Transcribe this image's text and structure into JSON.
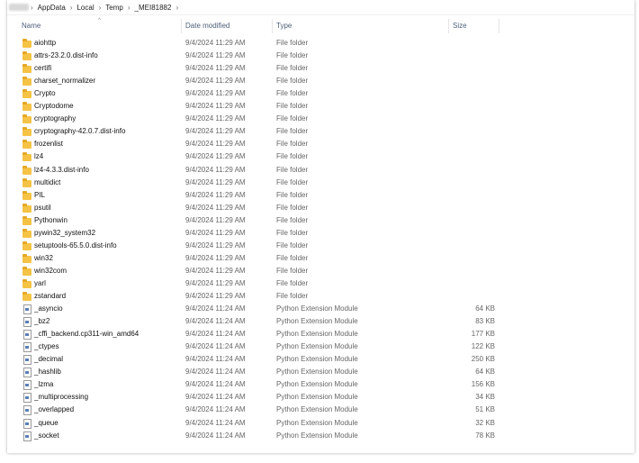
{
  "breadcrumb": [
    "AppData",
    "Local",
    "Temp",
    "_MEI81882"
  ],
  "columns": {
    "name": "Name",
    "date": "Date modified",
    "type": "Type",
    "size": "Size"
  },
  "files": [
    {
      "name": "aiohttp",
      "date": "9/4/2024 11:29 AM",
      "type": "File folder",
      "size": "",
      "kind": "folder"
    },
    {
      "name": "attrs-23.2.0.dist-info",
      "date": "9/4/2024 11:29 AM",
      "type": "File folder",
      "size": "",
      "kind": "folder"
    },
    {
      "name": "certifi",
      "date": "9/4/2024 11:29 AM",
      "type": "File folder",
      "size": "",
      "kind": "folder"
    },
    {
      "name": "charset_normalizer",
      "date": "9/4/2024 11:29 AM",
      "type": "File folder",
      "size": "",
      "kind": "folder"
    },
    {
      "name": "Crypto",
      "date": "9/4/2024 11:29 AM",
      "type": "File folder",
      "size": "",
      "kind": "folder"
    },
    {
      "name": "Cryptodome",
      "date": "9/4/2024 11:29 AM",
      "type": "File folder",
      "size": "",
      "kind": "folder"
    },
    {
      "name": "cryptography",
      "date": "9/4/2024 11:29 AM",
      "type": "File folder",
      "size": "",
      "kind": "folder"
    },
    {
      "name": "cryptography-42.0.7.dist-info",
      "date": "9/4/2024 11:29 AM",
      "type": "File folder",
      "size": "",
      "kind": "folder"
    },
    {
      "name": "frozenlist",
      "date": "9/4/2024 11:29 AM",
      "type": "File folder",
      "size": "",
      "kind": "folder"
    },
    {
      "name": "lz4",
      "date": "9/4/2024 11:29 AM",
      "type": "File folder",
      "size": "",
      "kind": "folder"
    },
    {
      "name": "lz4-4.3.3.dist-info",
      "date": "9/4/2024 11:29 AM",
      "type": "File folder",
      "size": "",
      "kind": "folder"
    },
    {
      "name": "multidict",
      "date": "9/4/2024 11:29 AM",
      "type": "File folder",
      "size": "",
      "kind": "folder"
    },
    {
      "name": "PIL",
      "date": "9/4/2024 11:29 AM",
      "type": "File folder",
      "size": "",
      "kind": "folder"
    },
    {
      "name": "psutil",
      "date": "9/4/2024 11:29 AM",
      "type": "File folder",
      "size": "",
      "kind": "folder"
    },
    {
      "name": "Pythonwin",
      "date": "9/4/2024 11:29 AM",
      "type": "File folder",
      "size": "",
      "kind": "folder"
    },
    {
      "name": "pywin32_system32",
      "date": "9/4/2024 11:29 AM",
      "type": "File folder",
      "size": "",
      "kind": "folder"
    },
    {
      "name": "setuptools-65.5.0.dist-info",
      "date": "9/4/2024 11:29 AM",
      "type": "File folder",
      "size": "",
      "kind": "folder"
    },
    {
      "name": "win32",
      "date": "9/4/2024 11:29 AM",
      "type": "File folder",
      "size": "",
      "kind": "folder"
    },
    {
      "name": "win32com",
      "date": "9/4/2024 11:29 AM",
      "type": "File folder",
      "size": "",
      "kind": "folder"
    },
    {
      "name": "yarl",
      "date": "9/4/2024 11:29 AM",
      "type": "File folder",
      "size": "",
      "kind": "folder"
    },
    {
      "name": "zstandard",
      "date": "9/4/2024 11:29 AM",
      "type": "File folder",
      "size": "",
      "kind": "folder"
    },
    {
      "name": "_asyncio",
      "date": "9/4/2024 11:24 AM",
      "type": "Python Extension Module",
      "size": "64 KB",
      "kind": "file"
    },
    {
      "name": "_bz2",
      "date": "9/4/2024 11:24 AM",
      "type": "Python Extension Module",
      "size": "83 KB",
      "kind": "file"
    },
    {
      "name": "_cffi_backend.cp311-win_amd64",
      "date": "9/4/2024 11:24 AM",
      "type": "Python Extension Module",
      "size": "177 KB",
      "kind": "file"
    },
    {
      "name": "_ctypes",
      "date": "9/4/2024 11:24 AM",
      "type": "Python Extension Module",
      "size": "122 KB",
      "kind": "file"
    },
    {
      "name": "_decimal",
      "date": "9/4/2024 11:24 AM",
      "type": "Python Extension Module",
      "size": "250 KB",
      "kind": "file"
    },
    {
      "name": "_hashlib",
      "date": "9/4/2024 11:24 AM",
      "type": "Python Extension Module",
      "size": "64 KB",
      "kind": "file"
    },
    {
      "name": "_lzma",
      "date": "9/4/2024 11:24 AM",
      "type": "Python Extension Module",
      "size": "156 KB",
      "kind": "file"
    },
    {
      "name": "_multiprocessing",
      "date": "9/4/2024 11:24 AM",
      "type": "Python Extension Module",
      "size": "34 KB",
      "kind": "file"
    },
    {
      "name": "_overlapped",
      "date": "9/4/2024 11:24 AM",
      "type": "Python Extension Module",
      "size": "51 KB",
      "kind": "file"
    },
    {
      "name": "_queue",
      "date": "9/4/2024 11:24 AM",
      "type": "Python Extension Module",
      "size": "32 KB",
      "kind": "file"
    },
    {
      "name": "_socket",
      "date": "9/4/2024 11:24 AM",
      "type": "Python Extension Module",
      "size": "78 KB",
      "kind": "file"
    }
  ]
}
